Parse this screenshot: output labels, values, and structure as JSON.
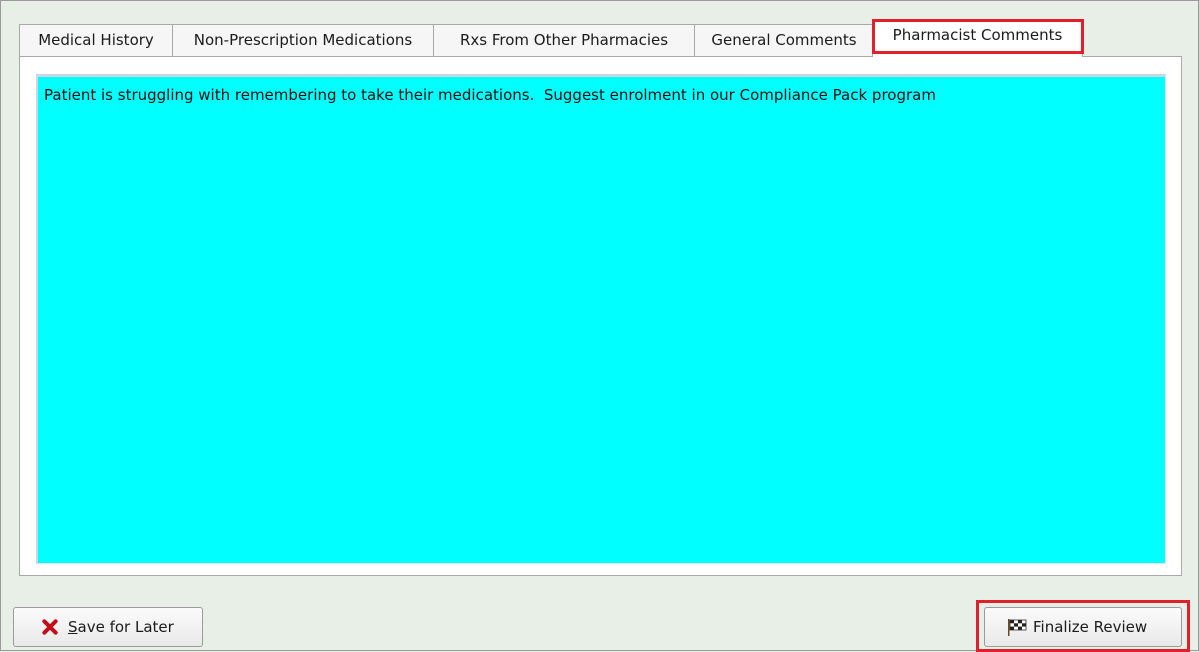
{
  "tabs": [
    {
      "label": "Medical History",
      "active": false
    },
    {
      "label": "Non-Prescription Medications",
      "active": false
    },
    {
      "label": "Rxs From Other Pharmacies",
      "active": false
    },
    {
      "label": "General Comments",
      "active": false
    },
    {
      "label": "Pharmacist Comments",
      "active": true
    }
  ],
  "comments": {
    "value": "Patient is struggling with remembering to take their medications.  Suggest enrolment in our Compliance Pack program"
  },
  "buttons": {
    "save_mnemonic": "S",
    "save_rest": "ave for Later",
    "save_icon": "close-x-icon",
    "finalize_label": "Finalize Review",
    "finalize_icon": "checkered-flag-icon"
  },
  "colors": {
    "comment_background": "#00ffff",
    "highlight": "#e0202a",
    "save_icon": "#c0101a"
  }
}
